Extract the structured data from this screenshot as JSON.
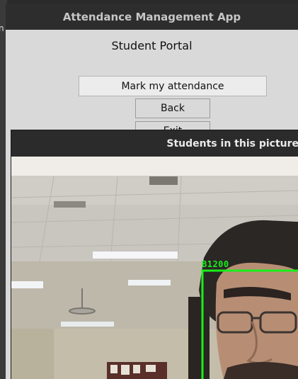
{
  "main_window": {
    "title": "Attendance Management App",
    "heading": "Student Portal",
    "mark_button": "Mark my attendance",
    "back_button": "Back",
    "exit_button": "Exit"
  },
  "dialog": {
    "title": "Students in this picture",
    "detection": {
      "label": "B1200",
      "box_color": "#19f019"
    }
  },
  "background_fragment": "n"
}
